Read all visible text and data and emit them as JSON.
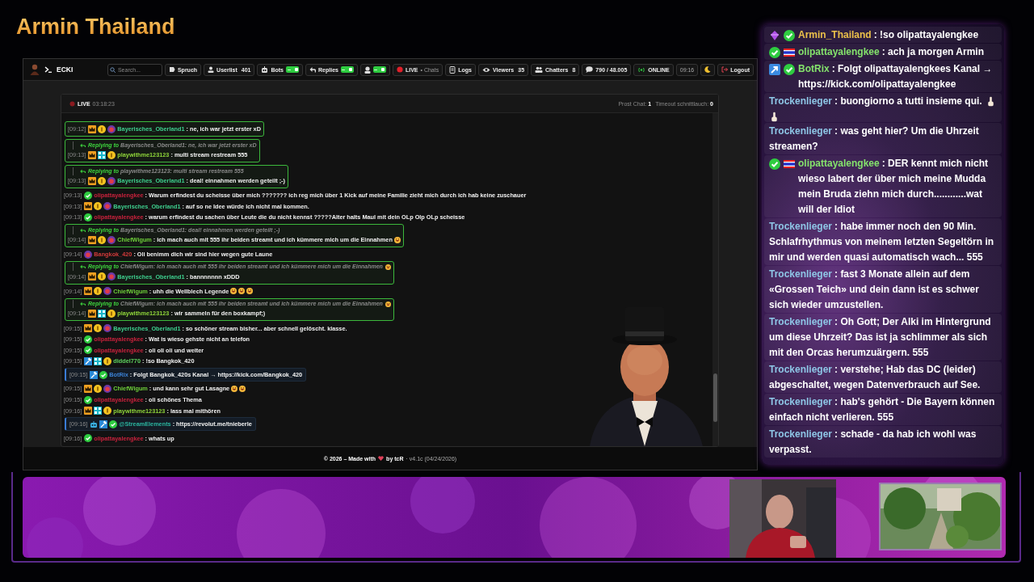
{
  "stream_title": "Armin Thailand",
  "app": {
    "brand": "ECKI",
    "toolbar": [
      {
        "kind": "search",
        "placeholder": "Search..."
      },
      {
        "kind": "button",
        "label": "Spruch"
      },
      {
        "kind": "button",
        "label": "Userlist",
        "count": "401"
      },
      {
        "kind": "toggle",
        "label": "Bots",
        "on": true
      },
      {
        "kind": "toggle",
        "label": "Replies",
        "on": true
      },
      {
        "kind": "toggle",
        "on": true
      },
      {
        "kind": "live",
        "label": "LIVE",
        "sub": "• Chats"
      },
      {
        "kind": "button",
        "label": "Logs"
      },
      {
        "kind": "button",
        "label": "Viewers",
        "count": "35"
      },
      {
        "kind": "button",
        "label": "Chatters",
        "count": "8"
      },
      {
        "kind": "button",
        "label": "790 / 48.005"
      },
      {
        "kind": "status",
        "label": "ONLINE"
      },
      {
        "kind": "clock",
        "label": "09:16"
      },
      {
        "kind": "icon"
      },
      {
        "kind": "logout",
        "label": "Logout"
      }
    ],
    "live_bar": {
      "label": "LIVE",
      "time": "03:18:23",
      "stats": [
        "Prost Chat: **1**",
        "Timeout schnittlauch: **0**"
      ]
    },
    "messages": [
      {
        "kind": "reply",
        "time": "[09:12]",
        "badges": [
          {
            "kind": "crown"
          },
          {
            "kind": "coin"
          },
          {
            "kind": "sub"
          }
        ],
        "user": "Bayerisches_Oberland1",
        "color": "#3ecf8e",
        "text": ": ne, ich war jetzt erster xD"
      },
      {
        "kind": "reply",
        "reply_to": {
          "label": "Replying to",
          "text": "Bayerisches_Oberland1: ne, ich war jetzt erster xD"
        },
        "time": "[09:13]",
        "badges": [
          {
            "kind": "crown"
          },
          {
            "kind": "grid"
          },
          {
            "kind": "coin"
          }
        ],
        "user": "playwithme123123",
        "color": "#8fd63a",
        "text": ": multi stream restream 555"
      },
      {
        "kind": "reply",
        "reply_to": {
          "label": "Replying to",
          "text": "playwithme123123: multi stream restream 555"
        },
        "time": "[09:13]",
        "badges": [
          {
            "kind": "crown"
          },
          {
            "kind": "coin"
          },
          {
            "kind": "sub"
          }
        ],
        "user": "Bayerisches_Oberland1",
        "color": "#3ecf8e",
        "text": ": deal! einnahmen werden geteilt ;-)"
      },
      {
        "kind": "message",
        "time": "[09:13]",
        "badges": [
          {
            "kind": "verified"
          }
        ],
        "user": "olipattayalengkee",
        "color": "#c8223c",
        "text": ": Warum erfindest du scheisse über mich ??????? ich reg mich über 1 Kick auf meine Familie zieht mich durch ich hab keine zuschauer"
      },
      {
        "kind": "message",
        "time": "[09:13]",
        "badges": [
          {
            "kind": "crown"
          },
          {
            "kind": "coin"
          },
          {
            "kind": "sub"
          }
        ],
        "user": "Bayerisches_Oberland1",
        "color": "#3ecf8e",
        "text": ": auf so ne Idee würde ich nicht mal kommen."
      },
      {
        "kind": "message",
        "time": "[09:13]",
        "badges": [
          {
            "kind": "verified"
          }
        ],
        "user": "olipattayalengkee",
        "color": "#c8223c",
        "text": ": warum erfindest du sachen über Leute die du nicht kennst ?????Alter halts Maul mit dein OLp Olp OLp scheisse"
      },
      {
        "kind": "reply",
        "reply_to": {
          "label": "Replying to",
          "text": "Bayerisches_Oberland1: deal! einnahmen werden geteilt ;-)"
        },
        "time": "[09:14]",
        "badges": [
          {
            "kind": "crown"
          },
          {
            "kind": "coin"
          },
          {
            "kind": "sub"
          }
        ],
        "user": "ChiefWigum",
        "color": "#6fd13a",
        "text": ": ich mach auch mit 555 ihr beiden streamt und ich kümmere mich um die Einnahmen",
        "emojis": [
          {
            "kind": "laugh"
          }
        ]
      },
      {
        "kind": "message",
        "time": "[09:14]",
        "badges": [
          {
            "kind": "sub"
          }
        ],
        "user": "Bangkok_420",
        "color": "#d23a3a",
        "text": ": Oli benimm dich wir sind hier wegen gute Laune"
      },
      {
        "kind": "reply",
        "reply_to": {
          "label": "Replying to",
          "text": "ChiefWigum: ich mach auch mit 555 ihr beiden streamt und ich kümmere mich um die Einnahmen",
          "emojis": [
            {
              "kind": "laugh"
            }
          ]
        },
        "time": "[09:14]",
        "badges": [
          {
            "kind": "crown"
          },
          {
            "kind": "coin"
          },
          {
            "kind": "sub"
          }
        ],
        "user": "Bayerisches_Oberland1",
        "color": "#3ecf8e",
        "text": ": bannnnnnn xDDD"
      },
      {
        "kind": "message",
        "time": "[09:14]",
        "badges": [
          {
            "kind": "crown"
          },
          {
            "kind": "coin"
          },
          {
            "kind": "sub"
          }
        ],
        "user": "ChiefWigum",
        "color": "#6fd13a",
        "text": ": uhh die Wellblech Legende",
        "emojis": [
          {
            "kind": "laugh"
          },
          {
            "kind": "laugh"
          },
          {
            "kind": "laugh"
          }
        ]
      },
      {
        "kind": "reply",
        "reply_to": {
          "label": "Replying to",
          "text": "ChiefWigum: ich mach auch mit 555 ihr beiden streamt und ich kümmere mich um die Einnahmen",
          "emojis": [
            {
              "kind": "laugh"
            }
          ]
        },
        "time": "[09:14]",
        "badges": [
          {
            "kind": "crown"
          },
          {
            "kind": "grid"
          },
          {
            "kind": "coin"
          }
        ],
        "user": "playwithme123123",
        "color": "#8fd63a",
        "text": ": wir sammeln für den boxkampf;)"
      },
      {
        "kind": "message",
        "time": "[09:15]",
        "badges": [
          {
            "kind": "crown"
          },
          {
            "kind": "coin"
          },
          {
            "kind": "sub"
          }
        ],
        "user": "Bayerisches_Oberland1",
        "color": "#3ecf8e",
        "text": ": so schöner stream bisher... aber schnell gelöscht. klasse."
      },
      {
        "kind": "message",
        "time": "[09:15]",
        "badges": [
          {
            "kind": "verified"
          }
        ],
        "user": "olipattayalengkee",
        "color": "#c8223c",
        "text": ": Wat is wieso gehste nicht an telefon"
      },
      {
        "kind": "message",
        "time": "[09:15]",
        "badges": [
          {
            "kind": "verified"
          }
        ],
        "user": "olipattayalengkee",
        "color": "#c8223c",
        "text": ": oli oli oli und weiter"
      },
      {
        "kind": "message",
        "time": "[09:15]",
        "badges": [
          {
            "kind": "hammer"
          },
          {
            "kind": "grid"
          },
          {
            "kind": "coin"
          }
        ],
        "user": "diddel770",
        "color": "#5ed35e",
        "text": ": !so Bangkok_420"
      },
      {
        "kind": "bot",
        "time": "[09:15]",
        "badges": [
          {
            "kind": "hammer"
          },
          {
            "kind": "verified"
          }
        ],
        "user": "BotRix",
        "color": "#3b82d6",
        "text": ": Folgt Bangkok_420s Kanal → https://kick.com/Bangkok_420"
      },
      {
        "kind": "message",
        "time": "[09:15]",
        "badges": [
          {
            "kind": "crown"
          },
          {
            "kind": "coin"
          },
          {
            "kind": "sub"
          }
        ],
        "user": "ChiefWigum",
        "color": "#6fd13a",
        "text": ": und kann sehr gut Lasagne",
        "emojis": [
          {
            "kind": "laugh"
          },
          {
            "kind": "laugh"
          }
        ]
      },
      {
        "kind": "message",
        "time": "[09:15]",
        "badges": [
          {
            "kind": "verified"
          }
        ],
        "user": "olipattayalengkee",
        "color": "#c8223c",
        "text": ": oli schönes Thema"
      },
      {
        "kind": "message",
        "time": "[09:16]",
        "badges": [
          {
            "kind": "crown"
          },
          {
            "kind": "grid"
          },
          {
            "kind": "coin"
          }
        ],
        "user": "playwithme123123",
        "color": "#8fd63a",
        "text": ": lass mal mithören"
      },
      {
        "kind": "bot",
        "time": "[09:16]",
        "badges": [
          {
            "kind": "bot"
          },
          {
            "kind": "hammer"
          },
          {
            "kind": "verified"
          }
        ],
        "user": "@StreamElements",
        "color": "#2bb5a0",
        "text": ": https://revolut.me/tnieberle"
      },
      {
        "kind": "message",
        "time": "[09:16]",
        "badges": [
          {
            "kind": "verified"
          }
        ],
        "user": "olipattayalengkee",
        "color": "#c8223c",
        "text": ": whats up"
      }
    ],
    "footer": {
      "made": "© 2026 – Made with",
      "by": "by tcR",
      "version": "· v4.1c (04/24/2026)"
    }
  },
  "side_chat": [
    {
      "badges": [
        {
          "kind": "gem"
        },
        {
          "kind": "verified"
        }
      ],
      "user": "Armin_Thailand",
      "color": "#ebc04a",
      "text": ": !so olipattayalengkee"
    },
    {
      "badges": [
        {
          "kind": "verified"
        },
        {
          "kind": "flag"
        }
      ],
      "user": "olipattayalengkee",
      "color": "#84e26c",
      "text": ": ach ja morgen Armin"
    },
    {
      "badges": [
        {
          "kind": "kick"
        },
        {
          "kind": "verified"
        }
      ],
      "user": "BotRix",
      "color": "#84e26c",
      "text": ": Folgt olipattayalengkees Kanal → https://kick.com/olipattayalengkee"
    },
    {
      "user": "Trockenlieger",
      "color": "#8ec6e6",
      "text": ": buongiorno a tutti insieme qui.",
      "emojis": [
        {
          "kind": "hand"
        },
        {
          "kind": "hand"
        }
      ]
    },
    {
      "user": "Trockenlieger",
      "color": "#8ec6e6",
      "text": ": was geht hier? Um die Uhrzeit streamen?"
    },
    {
      "badges": [
        {
          "kind": "verified"
        },
        {
          "kind": "flag"
        }
      ],
      "user": "olipattayalengkee",
      "color": "#84e26c",
      "text": ": DER kennt mich nicht wieso labert der über mich meine Mudda mein Bruda ziehn mich durch............wat will der Idiot"
    },
    {
      "user": "Trockenlieger",
      "color": "#8ec6e6",
      "text": ": habe immer noch den 90 Min. Schlafrhythmus von meinem letzten Segeltörn in mir und werden quasi automatisch wach... 555"
    },
    {
      "user": "Trockenlieger",
      "color": "#8ec6e6",
      "text": ": fast 3 Monate allein auf dem «Grossen Teich» und dein dann ist es schwer sich wieder umzustellen."
    },
    {
      "user": "Trockenlieger",
      "color": "#8ec6e6",
      "text": ": Oh Gott; Der Alki im Hintergrund um diese Uhrzeit? Das ist ja schlimmer als sich mit den Orcas herumzuärgern. 555"
    },
    {
      "user": "Trockenlieger",
      "color": "#8ec6e6",
      "text": ": verstehe; Hab das DC (leider) abgeschaltet, wegen Datenverbrauch auf See."
    },
    {
      "user": "Trockenlieger",
      "color": "#8ec6e6",
      "text": ": hab's gehört - Die Bayern können einfach nicht verlieren. 555"
    },
    {
      "user": "Trockenlieger",
      "color": "#8ec6e6",
      "text": ": schade - da hab ich wohl was verpasst."
    }
  ]
}
